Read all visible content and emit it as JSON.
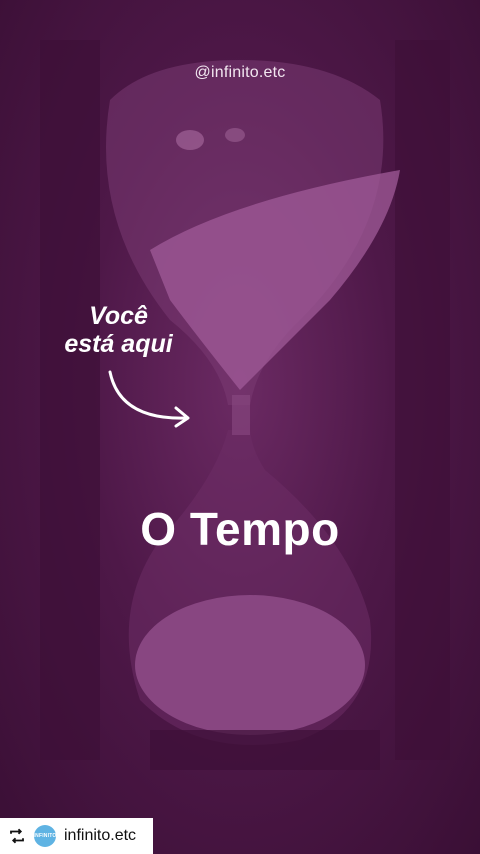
{
  "post": {
    "handle": "@infinito.etc",
    "annotation_line1": "Você",
    "annotation_line2": "está aqui",
    "title": "O Tempo"
  },
  "repost": {
    "icon": "repost-icon",
    "avatar_text": "INFINITO",
    "username": "infinito.etc"
  },
  "colors": {
    "overlay": "#4e1848",
    "text": "#ffffff",
    "avatar": "#5fb3e3"
  }
}
